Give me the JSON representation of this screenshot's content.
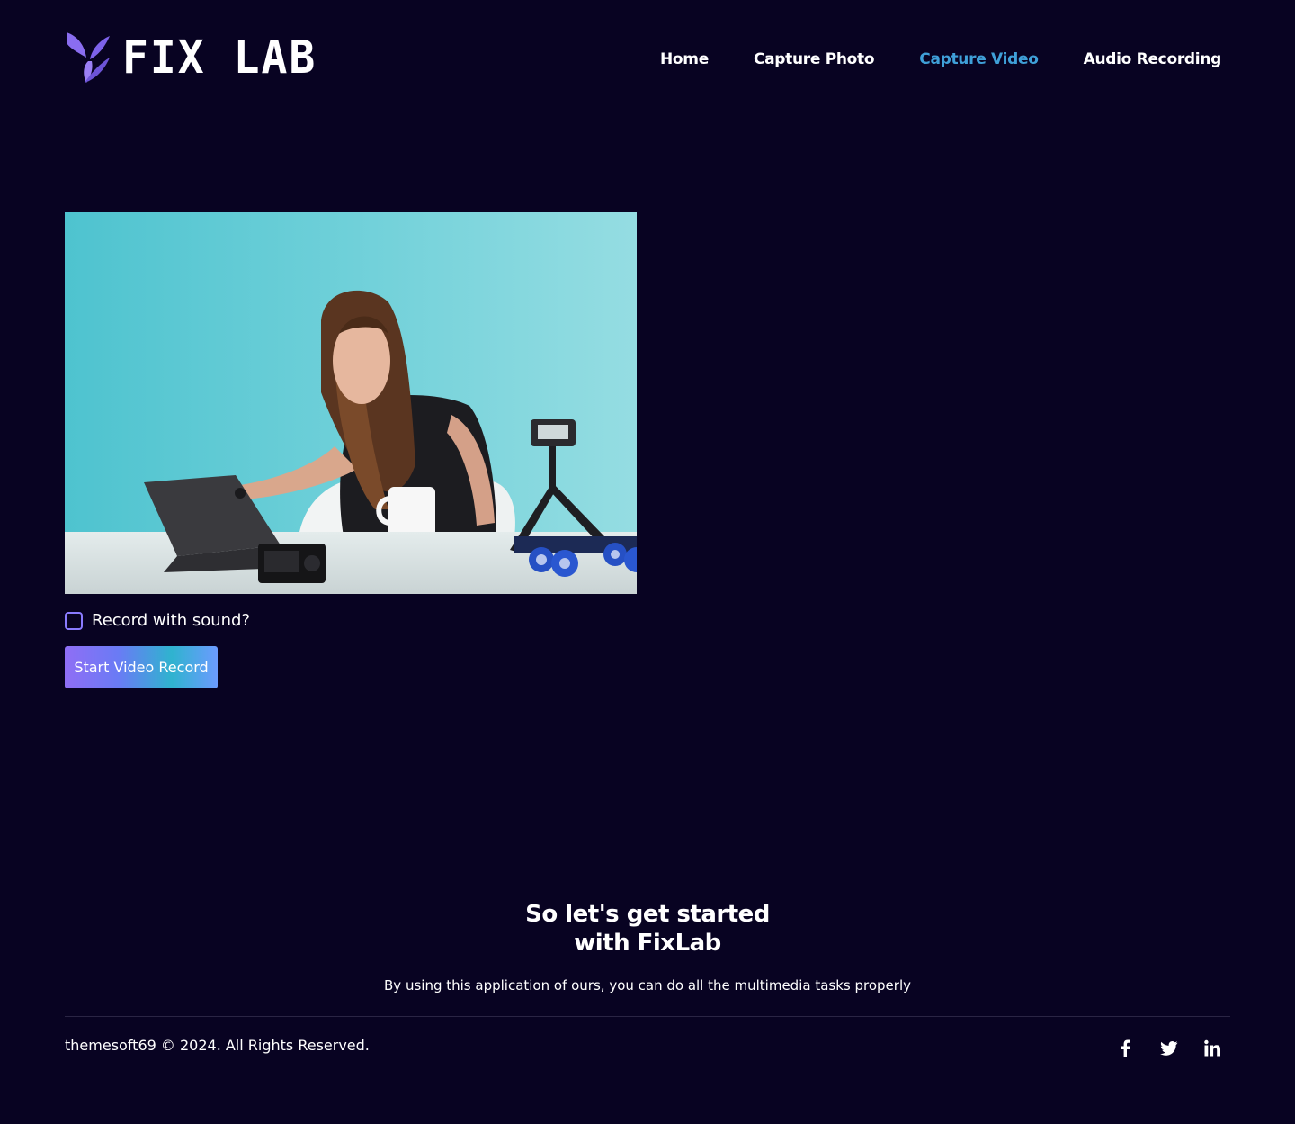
{
  "brand": {
    "name": "FIX LAB"
  },
  "nav": {
    "items": [
      {
        "label": "Home",
        "active": false
      },
      {
        "label": "Capture Photo",
        "active": false
      },
      {
        "label": "Capture Video",
        "active": true
      },
      {
        "label": "Audio Recording",
        "active": false
      }
    ]
  },
  "recorder": {
    "sound_option_label": "Record with sound?",
    "sound_option_checked": false,
    "start_button_label": "Start Video Record"
  },
  "cta": {
    "title_line1": "So let's get started",
    "title_line2": "with FixLab",
    "description": "By using this application of ours, you can do all the multimedia tasks properly"
  },
  "footer": {
    "copyright": "themesoft69 © 2024. All Rights Reserved.",
    "social": [
      "facebook-icon",
      "twitter-icon",
      "linkedin-icon"
    ]
  },
  "colors": {
    "background": "#080322",
    "accent": "#8a7bff",
    "nav_active": "#3fa0d8"
  }
}
